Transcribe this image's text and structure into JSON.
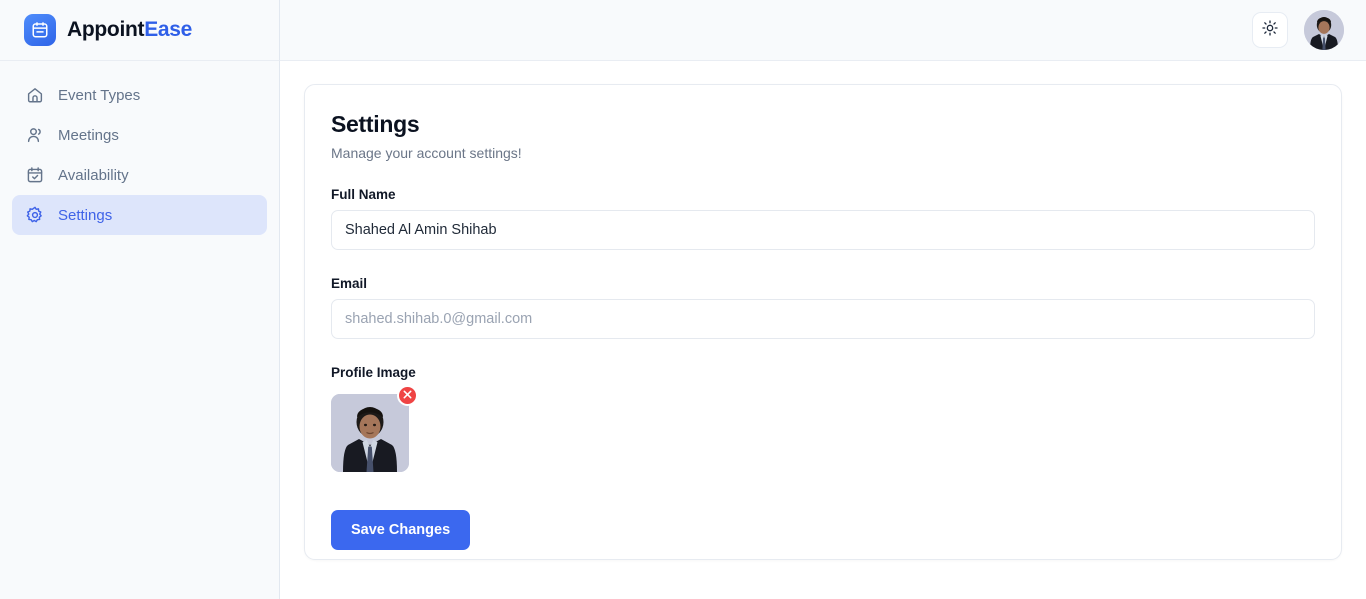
{
  "brand": {
    "name_part1": "Appoint",
    "name_part2": "Ease",
    "logo_icon": "calendar-icon",
    "accent_color": "#2f5fe8"
  },
  "header": {
    "theme_toggle_icon": "sun-icon",
    "avatar_icon": "user-avatar"
  },
  "sidebar": {
    "items": [
      {
        "label": "Event Types",
        "icon": "home-icon",
        "active": false
      },
      {
        "label": "Meetings",
        "icon": "users-icon",
        "active": false
      },
      {
        "label": "Availability",
        "icon": "calendar-check-icon",
        "active": false
      },
      {
        "label": "Settings",
        "icon": "gear-icon",
        "active": true
      }
    ],
    "active_bg": "#dde5fb",
    "active_color": "#3f63e8"
  },
  "settings": {
    "title": "Settings",
    "subtitle": "Manage your account settings!",
    "full_name": {
      "label": "Full Name",
      "value": "Shahed Al Amin Shihab",
      "placeholder": "Full Name"
    },
    "email": {
      "label": "Email",
      "value": "",
      "placeholder": "shahed.shihab.0@gmail.com"
    },
    "profile_image": {
      "label": "Profile Image",
      "remove_icon": "close-icon",
      "remove_color": "#ef4444"
    },
    "save_label": "Save Changes",
    "save_color": "#3b68ef"
  }
}
